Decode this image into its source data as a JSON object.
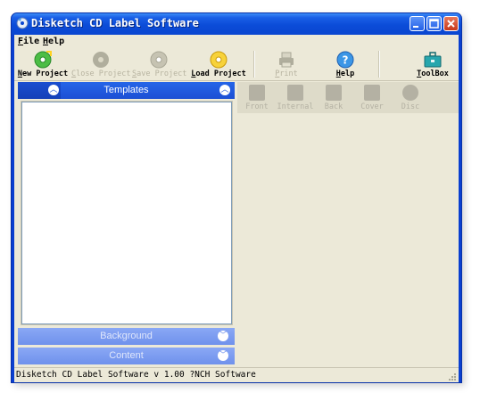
{
  "window": {
    "title": "Disketch CD Label Software"
  },
  "menu": {
    "items": [
      "File",
      "Help"
    ]
  },
  "toolbar": {
    "buttons": [
      {
        "label": "New Project",
        "icon": "new-project-icon",
        "enabled": true,
        "color": "#3aa83a"
      },
      {
        "label": "Close Project",
        "icon": "close-project-icon",
        "enabled": false,
        "color": "#a9a796"
      },
      {
        "label": "Save Project",
        "icon": "save-project-icon",
        "enabled": false,
        "color": "#a9a796"
      },
      {
        "label": "Load Project",
        "icon": "load-project-icon",
        "enabled": true,
        "color": "#f0c020"
      },
      {
        "label": "Print",
        "icon": "printer-icon",
        "enabled": false,
        "color": "#a9a796"
      },
      {
        "label": "Help",
        "icon": "help-icon",
        "enabled": true,
        "color": "#2f8fe0"
      },
      {
        "label": "ToolBox",
        "icon": "toolbox-icon",
        "enabled": true,
        "color": "#1f9aa0"
      }
    ]
  },
  "left_panel": {
    "templates_title": "Templates",
    "background_title": "Background",
    "content_title": "Content"
  },
  "view_tabs": [
    {
      "label": "Front",
      "shape": "square"
    },
    {
      "label": "Internal",
      "shape": "square"
    },
    {
      "label": "Back",
      "shape": "square"
    },
    {
      "label": "Cover",
      "shape": "square"
    },
    {
      "label": "Disc",
      "shape": "round"
    }
  ],
  "status": {
    "text": "Disketch CD Label Software v 1.00 ?NCH Software"
  },
  "colors": {
    "titlebar": "#0a46d0",
    "panel_header": "#1c4fd4",
    "panel_header_collapsed": "#6f91ec",
    "client_bg": "#ece9d8"
  }
}
